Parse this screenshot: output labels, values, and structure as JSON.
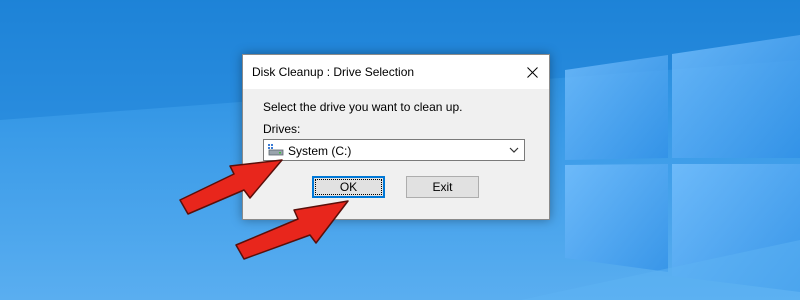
{
  "dialog": {
    "title": "Disk Cleanup : Drive Selection",
    "prompt": "Select the drive you want to clean up.",
    "drives_label": "Drives:",
    "selected_drive": "System (C:)",
    "ok_label": "OK",
    "exit_label": "Exit"
  },
  "icons": {
    "close": "close-icon",
    "drive": "hard-drive-icon",
    "dropdown": "chevron-down-icon",
    "annotation": "red-arrow-icon"
  },
  "colors": {
    "desktop_blue": "#1f86d9",
    "arrow_red": "#e8261c",
    "focus_blue": "#0078d7"
  }
}
